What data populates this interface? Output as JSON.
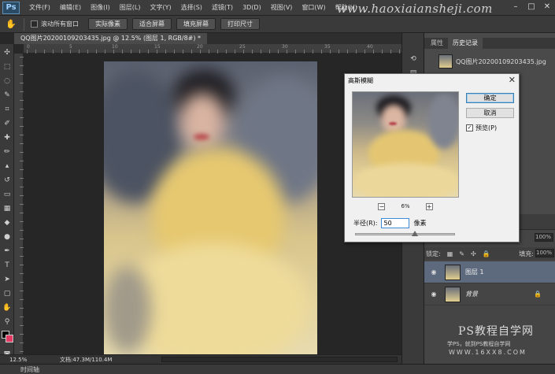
{
  "app": {
    "logo": "Ps",
    "watermark_site": "www.haoxiaiansheji.com"
  },
  "menu": [
    "文件(F)",
    "编辑(E)",
    "图像(I)",
    "图层(L)",
    "文字(Y)",
    "选择(S)",
    "滤镜(T)",
    "3D(D)",
    "视图(V)",
    "窗口(W)",
    "帮助(H)"
  ],
  "options_bar": {
    "scroll_all_label": "滚动所有窗口",
    "buttons": [
      "实际像素",
      "适合屏幕",
      "填充屏幕",
      "打印尺寸"
    ]
  },
  "document": {
    "tab_title": "QQ图片20200109203435.jpg @ 12.5% (图层 1, RGB/8#) *",
    "zoom": "12.5%",
    "doc_size": "文档:47.3M/110.4M"
  },
  "ruler": [
    "0",
    "5",
    "10",
    "15",
    "20",
    "25",
    "30",
    "35",
    "40"
  ],
  "history_panel": {
    "tabs": [
      "属性",
      "历史记录"
    ],
    "snapshot_name": "QQ图片20200109203435.jpg"
  },
  "layers_panel": {
    "lock_label": "锁定:",
    "fill_label": "填充:",
    "fill_value": "100%",
    "opacity_value": "100%",
    "layers": [
      {
        "name": "图层 1",
        "selected": true
      },
      {
        "name": "背景",
        "selected": false
      }
    ]
  },
  "dialog": {
    "title": "高斯模糊",
    "ok_label": "确定",
    "cancel_label": "取消",
    "preview_label": "预览(P)",
    "preview_checked": true,
    "zoom_value": "6%",
    "radius_label": "半径(R):",
    "radius_value": "50",
    "radius_unit": "像素",
    "slider_fraction": 0.6
  },
  "bottom": {
    "timeline_label": "时间轴"
  },
  "watermark": {
    "line1": "PS教程自学网",
    "line2": "学PS，就到PS教程自学网",
    "line3": "WWW.16XX8.COM"
  },
  "icons": [
    "hand-icon",
    "close-icon",
    "minimize-icon",
    "maximize-icon",
    "eye-icon",
    "lock-icon",
    "plus-icon",
    "minus-icon"
  ],
  "colors": {
    "foreground": "#000000",
    "background": "#e43a64",
    "selection": "#5d6a7d",
    "accent": "#3d8ad9"
  }
}
